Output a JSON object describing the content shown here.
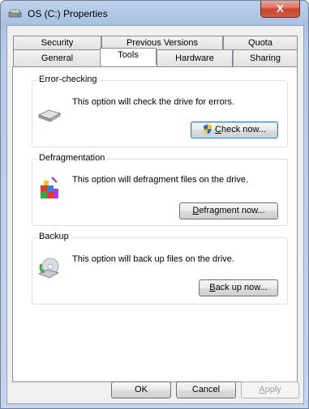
{
  "window": {
    "title": "OS (C:) Properties",
    "close_glyph": "X"
  },
  "tabs": {
    "row1": [
      {
        "label": "Security"
      },
      {
        "label": "Previous Versions"
      },
      {
        "label": "Quota"
      }
    ],
    "row2": [
      {
        "label": "General"
      },
      {
        "label": "Tools"
      },
      {
        "label": "Hardware"
      },
      {
        "label": "Sharing"
      }
    ],
    "active": "Tools"
  },
  "groups": {
    "error_checking": {
      "title": "Error-checking",
      "description": "This option will check the drive for errors.",
      "button": {
        "mnemonic": "C",
        "rest": "heck now..."
      }
    },
    "defragmentation": {
      "title": "Defragmentation",
      "description": "This option will defragment files on the drive.",
      "button": {
        "mnemonic": "D",
        "rest": "efragment now..."
      }
    },
    "backup": {
      "title": "Backup",
      "description": "This option will back up files on the drive.",
      "button": {
        "mnemonic": "B",
        "rest": "ack up now..."
      }
    }
  },
  "footer": {
    "ok": "OK",
    "cancel": "Cancel",
    "apply_mnemonic": "A",
    "apply_rest": "pply"
  },
  "icons": [
    "drive-icon",
    "shield-icon",
    "defragment-icon",
    "backup-icon",
    "close-icon"
  ]
}
